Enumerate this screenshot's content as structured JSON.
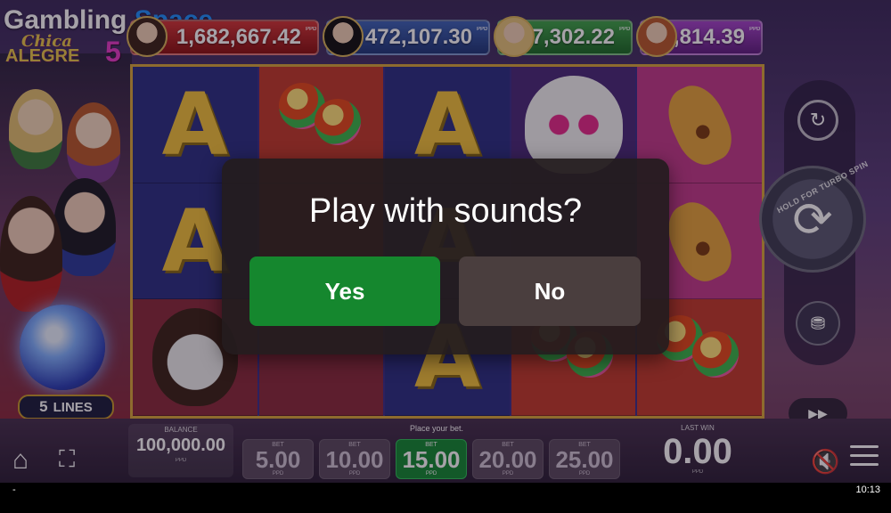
{
  "brand": {
    "word1": "Gambling",
    "word2": "Space"
  },
  "game_title": {
    "line1": "Chica",
    "line2": "ALEGRE",
    "number": "5"
  },
  "jackpots": [
    {
      "amount": "1,682,667.42",
      "currency": "PPD",
      "color": "#c42828"
    },
    {
      "amount": "472,107.30",
      "currency": "PPD",
      "color": "#2f54a8"
    },
    {
      "amount": "37,302.22",
      "currency": "PPD",
      "color": "#2f9a3c"
    },
    {
      "amount": "15,814.39",
      "currency": "PPD",
      "color": "#8e3ab8"
    }
  ],
  "reels": [
    [
      "A",
      "A",
      "catrina"
    ],
    [
      "maraca",
      "",
      ""
    ],
    [
      "A",
      "A",
      "A"
    ],
    [
      "skull",
      "",
      "maraca"
    ],
    [
      "guitar",
      "guitar",
      "maraca"
    ]
  ],
  "lines": {
    "count": "5",
    "label": "LINES"
  },
  "controls": {
    "turbo_hint": "HOLD FOR TURBO SPIN",
    "autoplay_icon": "autoplay-icon",
    "spin_icon": "spin-icon",
    "coins_icon": "coins-icon",
    "fast_icon": "fast-forward-icon"
  },
  "balance": {
    "label": "BALANCE",
    "value": "100,000.00",
    "currency": "PPD"
  },
  "bet": {
    "prompt": "Place your bet.",
    "options": [
      {
        "label": "BET",
        "value": "5.00",
        "currency": "PPD"
      },
      {
        "label": "BET",
        "value": "10.00",
        "currency": "PPD"
      },
      {
        "label": "BET",
        "value": "15.00",
        "currency": "PPD",
        "selected": true
      },
      {
        "label": "BET",
        "value": "20.00",
        "currency": "PPD"
      },
      {
        "label": "BET",
        "value": "25.00",
        "currency": "PPD"
      }
    ]
  },
  "last_win": {
    "label": "LAST WIN",
    "value": "0.00",
    "currency": "PPD"
  },
  "dialog": {
    "question": "Play with sounds?",
    "yes": "Yes",
    "no": "No"
  },
  "system": {
    "left": "-",
    "time": "10:13"
  },
  "colors": {
    "accent_green": "#15872e",
    "reel_border": "#d8a63a",
    "brand_blue": "#1e90ff"
  }
}
